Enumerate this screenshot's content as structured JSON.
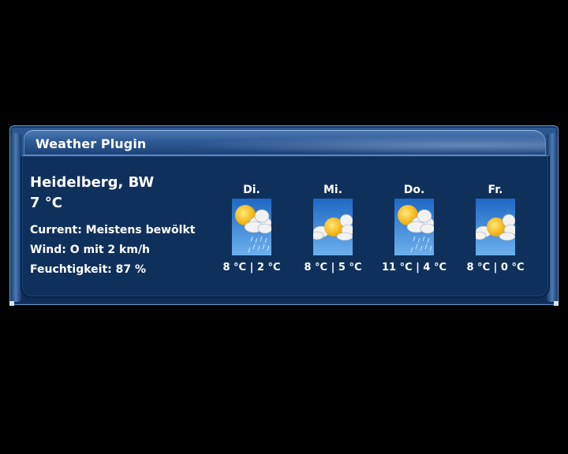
{
  "header": {
    "title": "Weather Plugin"
  },
  "current": {
    "location": "Heidelberg, BW",
    "temperature": "7 °C",
    "condition": "Current: Meistens bewölkt",
    "wind": "Wind: O mit 2 km/h",
    "humidity": "Feuchtigkeit: 87 %"
  },
  "forecast": [
    {
      "day": "Di.",
      "temps": "8 °C | 2 °C",
      "icon": "partly-cloudy-rain-icon"
    },
    {
      "day": "Mi.",
      "temps": "8 °C | 5 °C",
      "icon": "sun-behind-clouds-icon"
    },
    {
      "day": "Do.",
      "temps": "11 °C | 4 °C",
      "icon": "partly-cloudy-rain-icon"
    },
    {
      "day": "Fr.",
      "temps": "8 °C | 0 °C",
      "icon": "sun-behind-clouds-icon"
    }
  ],
  "colors": {
    "background": "#000000",
    "panel": "#10305c",
    "frame": "#2c5a93",
    "text": "#ffffff",
    "sky": "#2f7ed8"
  }
}
